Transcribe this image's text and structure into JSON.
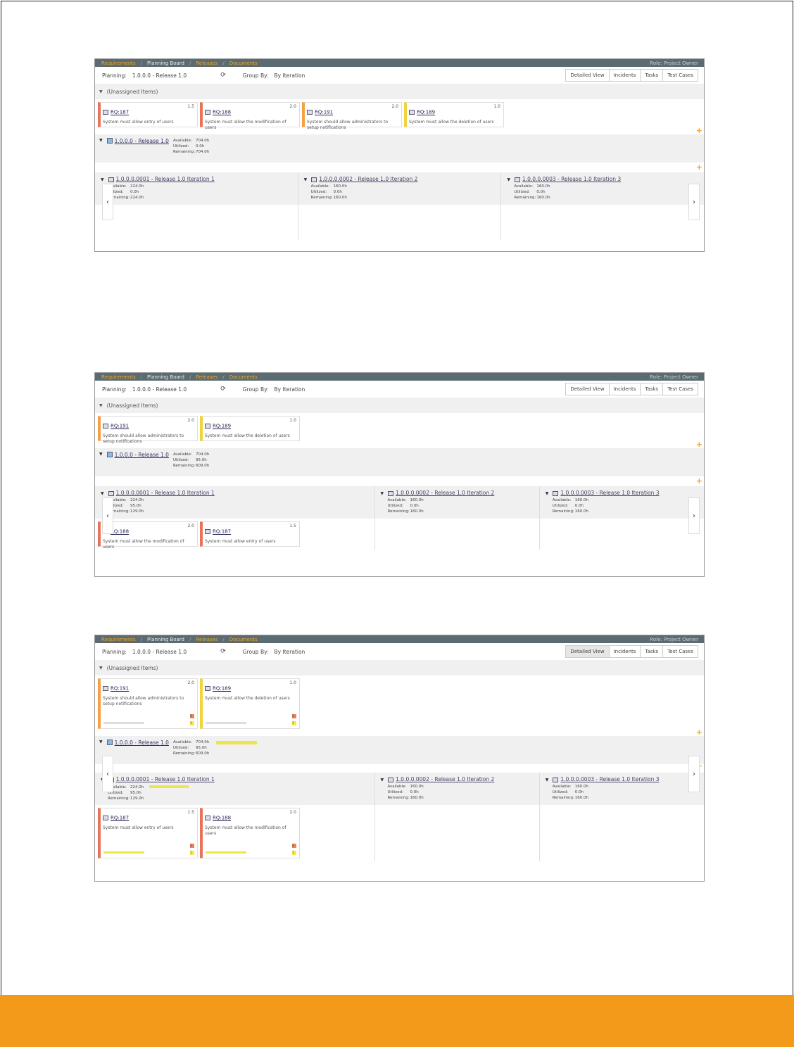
{
  "colors": {
    "accent": "#f5a623",
    "footer": "#f39a1a",
    "crumb_bg": "#5a6b72"
  },
  "crumbs": [
    "Requirements",
    "Planning Board",
    "Releases",
    "Documents"
  ],
  "role": "Role: Project Owner",
  "toolbar": {
    "planning_label": "Planning:",
    "planning_value": "1.0.0.0 - Release 1.0",
    "groupby_label": "Group By:",
    "groupby_value": "By Iteration",
    "refresh_icon": "refresh-icon"
  },
  "views": [
    "Detailed View",
    "Incidents",
    "Tasks",
    "Test Cases"
  ],
  "unassigned": "(Unassigned Items)",
  "release": {
    "name": "1.0.0.0 - Release 1.0"
  },
  "stat_labels": {
    "available": "Available:",
    "utilized": "Utilized:",
    "remaining": "Remaining:"
  },
  "iterations": [
    {
      "name": "1.0.0.0.0001 - Release 1.0 Iteration 1",
      "available": "224.0h"
    },
    {
      "name": "1.0.0.0.0002 - Release 1.0 Iteration 2",
      "available": "160.0h"
    },
    {
      "name": "1.0.0.0.0003 - Release 1.0 Iteration 3",
      "available": "160.0h"
    }
  ],
  "requirements": {
    "rq187": {
      "id": "RQ:187",
      "points": "1.5",
      "desc": "System must allow entry of users"
    },
    "rq188": {
      "id": "RQ:188",
      "points": "2.0",
      "desc": "System must allow the modification of users"
    },
    "rq191": {
      "id": "RQ:191",
      "points": "2.0",
      "desc": "System should allow administrators to setup notifications"
    },
    "rq189": {
      "id": "RQ:189",
      "points": "1.0",
      "desc": "System must allow the deletion of users"
    }
  },
  "shot1": {
    "release_stats": {
      "available": "704.0h",
      "utilized": "0.0h",
      "remaining": "704.0h"
    },
    "iter_stats": [
      {
        "utilized": "0.0h",
        "remaining": "224.0h"
      },
      {
        "utilized": "0.0h",
        "remaining": "160.0h"
      },
      {
        "utilized": "0.0h",
        "remaining": "160.0h"
      }
    ]
  },
  "shot2": {
    "release_stats": {
      "available": "704.0h",
      "utilized": "95.0h",
      "remaining": "609.0h"
    },
    "iter_stats": [
      {
        "utilized": "95.0h",
        "remaining": "129.0h"
      },
      {
        "utilized": "0.0h",
        "remaining": "160.0h"
      },
      {
        "utilized": "0.0h",
        "remaining": "160.0h"
      }
    ]
  },
  "shot3": {
    "release_stats": {
      "available": "704.0h",
      "utilized": "95.0h",
      "remaining": "609.0h"
    },
    "iter_stats": [
      {
        "utilized": "95.0h",
        "remaining": "129.0h"
      },
      {
        "utilized": "0.0h",
        "remaining": "160.0h"
      },
      {
        "utilized": "0.0h",
        "remaining": "160.0h"
      }
    ],
    "badges": {
      "rq191": [
        "2",
        "1"
      ],
      "rq189": [
        "2",
        "1"
      ],
      "rq187": [
        "3",
        "1"
      ],
      "rq188": [
        "4",
        "1"
      ]
    }
  }
}
